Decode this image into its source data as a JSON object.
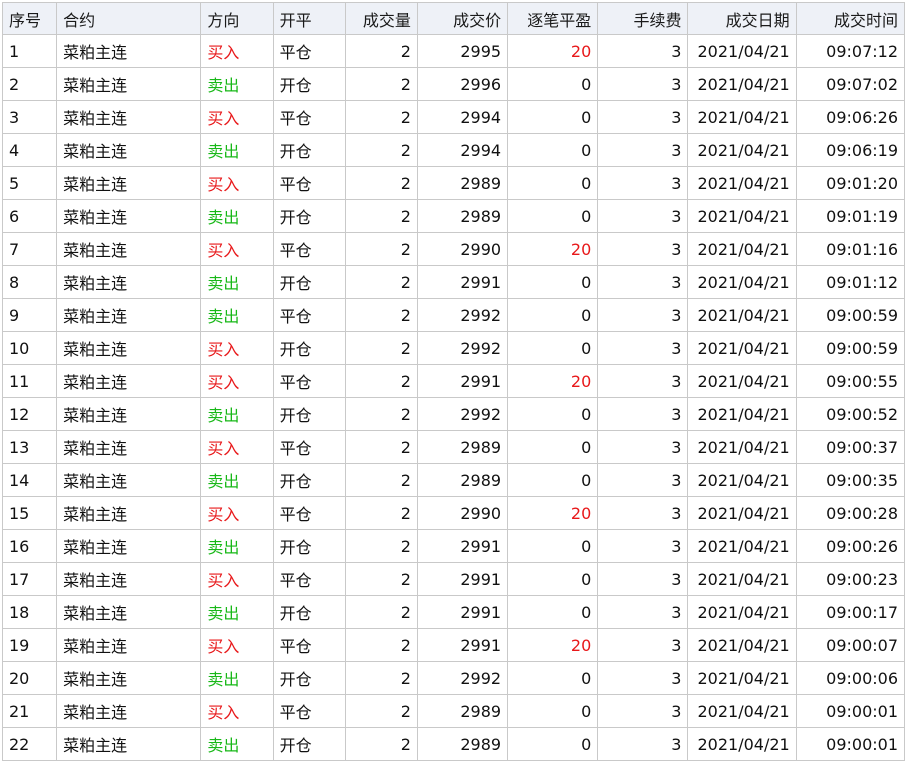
{
  "colors": {
    "buy": "#e8181a",
    "sell": "#18b818",
    "pnl_positive": "#e8181a"
  },
  "columns": [
    "序号",
    "合约",
    "方向",
    "开平",
    "成交量",
    "成交价",
    "逐笔平盈",
    "手续费",
    "成交日期",
    "成交时间"
  ],
  "rows": [
    {
      "no": "1",
      "contract": "菜粕主连",
      "dir": "买入",
      "oc": "平仓",
      "qty": "2",
      "price": "2995",
      "pnl": "20",
      "fee": "3",
      "date": "2021/04/21",
      "time": "09:07:12"
    },
    {
      "no": "2",
      "contract": "菜粕主连",
      "dir": "卖出",
      "oc": "开仓",
      "qty": "2",
      "price": "2996",
      "pnl": "0",
      "fee": "3",
      "date": "2021/04/21",
      "time": "09:07:02"
    },
    {
      "no": "3",
      "contract": "菜粕主连",
      "dir": "买入",
      "oc": "平仓",
      "qty": "2",
      "price": "2994",
      "pnl": "0",
      "fee": "3",
      "date": "2021/04/21",
      "time": "09:06:26"
    },
    {
      "no": "4",
      "contract": "菜粕主连",
      "dir": "卖出",
      "oc": "开仓",
      "qty": "2",
      "price": "2994",
      "pnl": "0",
      "fee": "3",
      "date": "2021/04/21",
      "time": "09:06:19"
    },
    {
      "no": "5",
      "contract": "菜粕主连",
      "dir": "买入",
      "oc": "平仓",
      "qty": "2",
      "price": "2989",
      "pnl": "0",
      "fee": "3",
      "date": "2021/04/21",
      "time": "09:01:20"
    },
    {
      "no": "6",
      "contract": "菜粕主连",
      "dir": "卖出",
      "oc": "开仓",
      "qty": "2",
      "price": "2989",
      "pnl": "0",
      "fee": "3",
      "date": "2021/04/21",
      "time": "09:01:19"
    },
    {
      "no": "7",
      "contract": "菜粕主连",
      "dir": "买入",
      "oc": "平仓",
      "qty": "2",
      "price": "2990",
      "pnl": "20",
      "fee": "3",
      "date": "2021/04/21",
      "time": "09:01:16"
    },
    {
      "no": "8",
      "contract": "菜粕主连",
      "dir": "卖出",
      "oc": "开仓",
      "qty": "2",
      "price": "2991",
      "pnl": "0",
      "fee": "3",
      "date": "2021/04/21",
      "time": "09:01:12"
    },
    {
      "no": "9",
      "contract": "菜粕主连",
      "dir": "卖出",
      "oc": "平仓",
      "qty": "2",
      "price": "2992",
      "pnl": "0",
      "fee": "3",
      "date": "2021/04/21",
      "time": "09:00:59"
    },
    {
      "no": "10",
      "contract": "菜粕主连",
      "dir": "买入",
      "oc": "开仓",
      "qty": "2",
      "price": "2992",
      "pnl": "0",
      "fee": "3",
      "date": "2021/04/21",
      "time": "09:00:59"
    },
    {
      "no": "11",
      "contract": "菜粕主连",
      "dir": "买入",
      "oc": "平仓",
      "qty": "2",
      "price": "2991",
      "pnl": "20",
      "fee": "3",
      "date": "2021/04/21",
      "time": "09:00:55"
    },
    {
      "no": "12",
      "contract": "菜粕主连",
      "dir": "卖出",
      "oc": "开仓",
      "qty": "2",
      "price": "2992",
      "pnl": "0",
      "fee": "3",
      "date": "2021/04/21",
      "time": "09:00:52"
    },
    {
      "no": "13",
      "contract": "菜粕主连",
      "dir": "买入",
      "oc": "平仓",
      "qty": "2",
      "price": "2989",
      "pnl": "0",
      "fee": "3",
      "date": "2021/04/21",
      "time": "09:00:37"
    },
    {
      "no": "14",
      "contract": "菜粕主连",
      "dir": "卖出",
      "oc": "开仓",
      "qty": "2",
      "price": "2989",
      "pnl": "0",
      "fee": "3",
      "date": "2021/04/21",
      "time": "09:00:35"
    },
    {
      "no": "15",
      "contract": "菜粕主连",
      "dir": "买入",
      "oc": "平仓",
      "qty": "2",
      "price": "2990",
      "pnl": "20",
      "fee": "3",
      "date": "2021/04/21",
      "time": "09:00:28"
    },
    {
      "no": "16",
      "contract": "菜粕主连",
      "dir": "卖出",
      "oc": "开仓",
      "qty": "2",
      "price": "2991",
      "pnl": "0",
      "fee": "3",
      "date": "2021/04/21",
      "time": "09:00:26"
    },
    {
      "no": "17",
      "contract": "菜粕主连",
      "dir": "买入",
      "oc": "平仓",
      "qty": "2",
      "price": "2991",
      "pnl": "0",
      "fee": "3",
      "date": "2021/04/21",
      "time": "09:00:23"
    },
    {
      "no": "18",
      "contract": "菜粕主连",
      "dir": "卖出",
      "oc": "开仓",
      "qty": "2",
      "price": "2991",
      "pnl": "0",
      "fee": "3",
      "date": "2021/04/21",
      "time": "09:00:17"
    },
    {
      "no": "19",
      "contract": "菜粕主连",
      "dir": "买入",
      "oc": "平仓",
      "qty": "2",
      "price": "2991",
      "pnl": "20",
      "fee": "3",
      "date": "2021/04/21",
      "time": "09:00:07"
    },
    {
      "no": "20",
      "contract": "菜粕主连",
      "dir": "卖出",
      "oc": "开仓",
      "qty": "2",
      "price": "2992",
      "pnl": "0",
      "fee": "3",
      "date": "2021/04/21",
      "time": "09:00:06"
    },
    {
      "no": "21",
      "contract": "菜粕主连",
      "dir": "买入",
      "oc": "平仓",
      "qty": "2",
      "price": "2989",
      "pnl": "0",
      "fee": "3",
      "date": "2021/04/21",
      "time": "09:00:01"
    },
    {
      "no": "22",
      "contract": "菜粕主连",
      "dir": "卖出",
      "oc": "开仓",
      "qty": "2",
      "price": "2989",
      "pnl": "0",
      "fee": "3",
      "date": "2021/04/21",
      "time": "09:00:01"
    }
  ]
}
